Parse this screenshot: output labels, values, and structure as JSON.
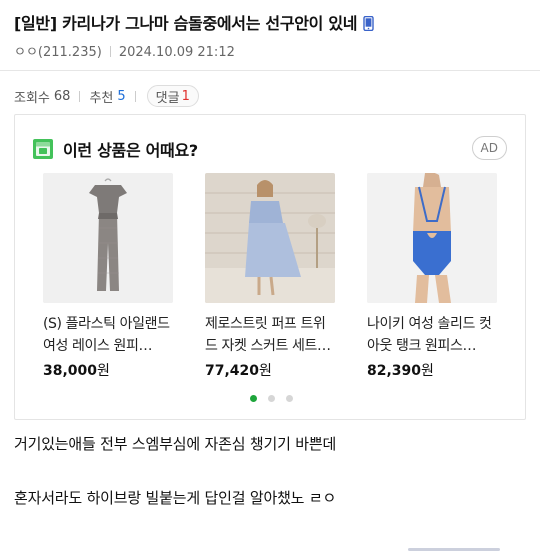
{
  "post": {
    "title": "[일반] 카리나가 그나마 슴돌중에서는 선구안이 있네",
    "author": "ㅇㅇ(211.235)",
    "datetime": "2024.10.09 21:12"
  },
  "stats": {
    "views_label": "조회수",
    "views": "68",
    "recommend_label": "추천",
    "recommend": "5",
    "comments_label": "댓글",
    "comments": "1"
  },
  "ad": {
    "heading": "이런 상품은 어때요?",
    "badge": "AD",
    "products": [
      {
        "name": "(S) 플라스틱 아일랜드 여성 레이스 원피…",
        "price": "38,000",
        "unit": "원"
      },
      {
        "name": "제로스트릿 퍼프 트위드 자켓 스커트 세트…",
        "price": "77,420",
        "unit": "원"
      },
      {
        "name": "나이키 여성 솔리드 컷아웃 탱크 원피스…",
        "price": "82,390",
        "unit": "원"
      }
    ],
    "page_count": 3,
    "active_page": 1
  },
  "content": {
    "line1": "거기있는애들 전부 스엠부심에 자존심 챙기기 바쁜데",
    "line2": "혼자서라도 하이브랑 빌붙는게 답인걸 알아챘노 ㄹㅇ"
  },
  "colors": {
    "accent_blue": "#1e6fd9",
    "accent_red": "#e0312e",
    "dot_active": "#1ea53b"
  },
  "icons": {
    "phone": "mobile-phone-icon",
    "ad_logo": "shopping-logo-icon"
  }
}
